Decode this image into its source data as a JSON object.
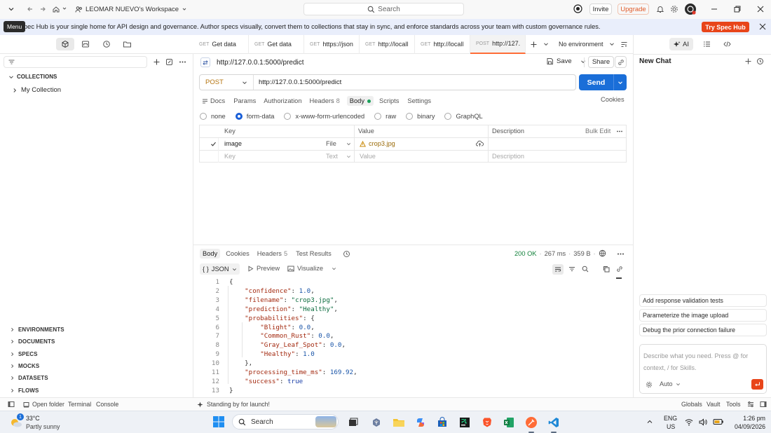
{
  "titlebar": {
    "workspace": "LEOMAR NUEVO's Workspace",
    "search_placeholder": "Search",
    "invite": "Invite",
    "upgrade": "Upgrade",
    "menu_tooltip": "Menu"
  },
  "banner": {
    "text": "pec Hub is your single home for API design and governance. Author specs visually, convert them to collections that stay in sync, and enforce standards across your team with custom governance rules.",
    "cta": "Try Spec Hub"
  },
  "sidebar": {
    "collections_header": "COLLECTIONS",
    "collection_item": "My Collection",
    "sections": [
      "ENVIRONMENTS",
      "DOCUMENTS",
      "SPECS",
      "MOCKS",
      "DATASETS",
      "FLOWS"
    ]
  },
  "tabs": [
    {
      "method": "GET",
      "label": "Get data",
      "dot": false
    },
    {
      "method": "GET",
      "label": "Get data",
      "dot": false
    },
    {
      "method": "GET",
      "label": "https://json",
      "dot": true
    },
    {
      "method": "GET",
      "label": "http://locall",
      "dot": true
    },
    {
      "method": "GET",
      "label": "http://locall",
      "dot": true
    },
    {
      "method": "POST",
      "label": "http://127.",
      "dot": true
    }
  ],
  "environment": "No environment",
  "request": {
    "title": "http://127.0.0.1:5000/predict",
    "save": "Save",
    "share": "Share",
    "method": "POST",
    "url": "http://127.0.0.1:5000/predict",
    "send": "Send",
    "subtabs": {
      "docs": "Docs",
      "params": "Params",
      "authorization": "Authorization",
      "headers": "Headers",
      "headers_count": "8",
      "body": "Body",
      "scripts": "Scripts",
      "settings": "Settings",
      "cookies": "Cookies"
    },
    "body_types": [
      "none",
      "form-data",
      "x-www-form-urlencoded",
      "raw",
      "binary",
      "GraphQL"
    ],
    "selected_body_type": "form-data",
    "form_table": {
      "headers": {
        "key": "Key",
        "value": "Value",
        "description": "Description",
        "bulk_edit": "Bulk Edit"
      },
      "row": {
        "key": "image",
        "type": "File",
        "value": "crop3.jpg"
      },
      "placeholder": {
        "key": "Key",
        "type": "Text",
        "value": "Value",
        "description": "Description"
      }
    }
  },
  "response": {
    "tabs": {
      "body": "Body",
      "cookies": "Cookies",
      "headers": "Headers",
      "headers_count": "5",
      "test_results": "Test Results"
    },
    "status": "200 OK",
    "time": "267 ms",
    "size": "359 B",
    "format": "JSON",
    "preview": "Preview",
    "visualize": "Visualize",
    "lines": [
      {
        "n": "1",
        "text": "{"
      },
      {
        "n": "2",
        "text": "    \"confidence\": 1.0,"
      },
      {
        "n": "3",
        "text": "    \"filename\": \"crop3.jpg\","
      },
      {
        "n": "4",
        "text": "    \"prediction\": \"Healthy\","
      },
      {
        "n": "5",
        "text": "    \"probabilities\": {"
      },
      {
        "n": "6",
        "text": "        \"Blight\": 0.0,"
      },
      {
        "n": "7",
        "text": "        \"Common_Rust\": 0.0,"
      },
      {
        "n": "8",
        "text": "        \"Gray_Leaf_Spot\": 0.0,"
      },
      {
        "n": "9",
        "text": "        \"Healthy\": 1.0"
      },
      {
        "n": "10",
        "text": "    },"
      },
      {
        "n": "11",
        "text": "    \"processing_time_ms\": 169.92,"
      },
      {
        "n": "12",
        "text": "    \"success\": true"
      },
      {
        "n": "13",
        "text": "}"
      }
    ]
  },
  "right_panel": {
    "ai": "AI",
    "new_chat": "New Chat",
    "suggestions": [
      "Add response validation tests",
      "Parameterize the image upload",
      "Debug the prior connection failure"
    ],
    "prompt_placeholder": "Describe what you need. Press @ for context, / for Skills.",
    "mode": "Auto"
  },
  "statusbar": {
    "open_folder": "Open folder",
    "terminal": "Terminal",
    "console": "Console",
    "standing": "Standing by for launch!",
    "globals": "Globals",
    "vault": "Vault",
    "tools": "Tools"
  },
  "taskbar": {
    "weather_temp": "33°C",
    "weather_desc": "Partly sunny",
    "weather_badge": "1",
    "search": "Search",
    "lang": "ENG",
    "region": "US",
    "time": "1:26 pm",
    "date": "04/09/2026"
  },
  "colors": {
    "accent": "#1a6ed8",
    "brand": "#ff6c37",
    "ok": "#12813b"
  }
}
